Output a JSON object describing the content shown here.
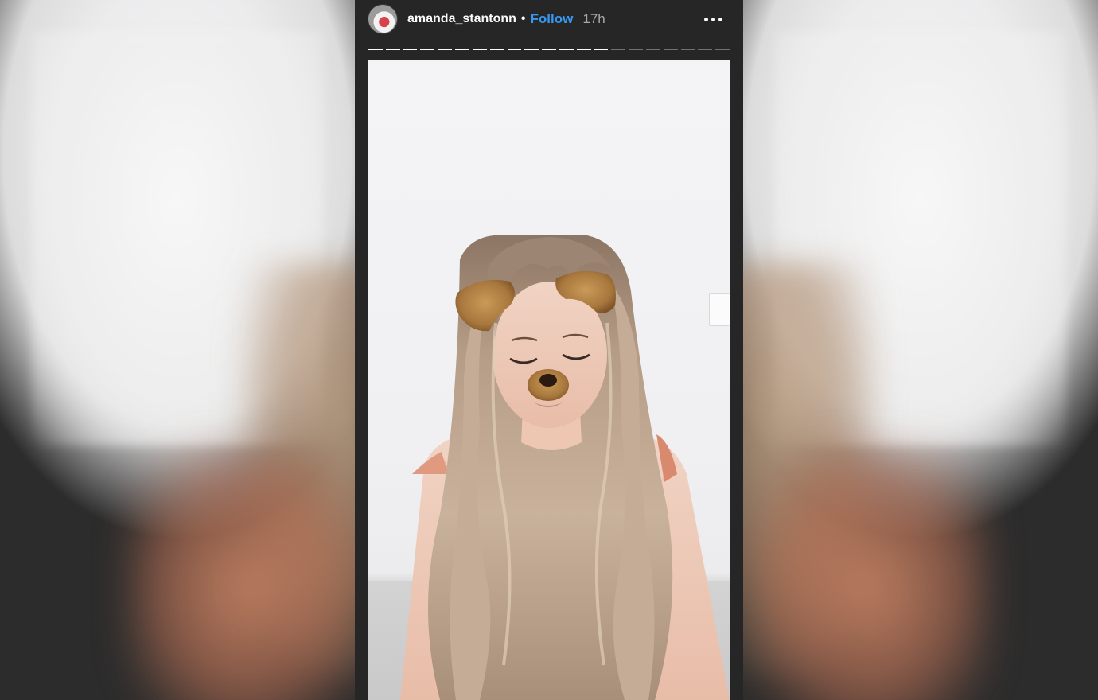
{
  "story": {
    "username": "amanda_stantonn",
    "separator": "•",
    "follow_label": "Follow",
    "timestamp": "17h",
    "progress": {
      "segments": 21,
      "completed": 14
    }
  },
  "icons": {
    "avatar": "profile-avatar",
    "more": "more-options-icon"
  },
  "colors": {
    "follow": "#3897f0",
    "background": "#262626"
  },
  "media": {
    "description_kind": "photo",
    "filter": "dog-ears-filter"
  }
}
